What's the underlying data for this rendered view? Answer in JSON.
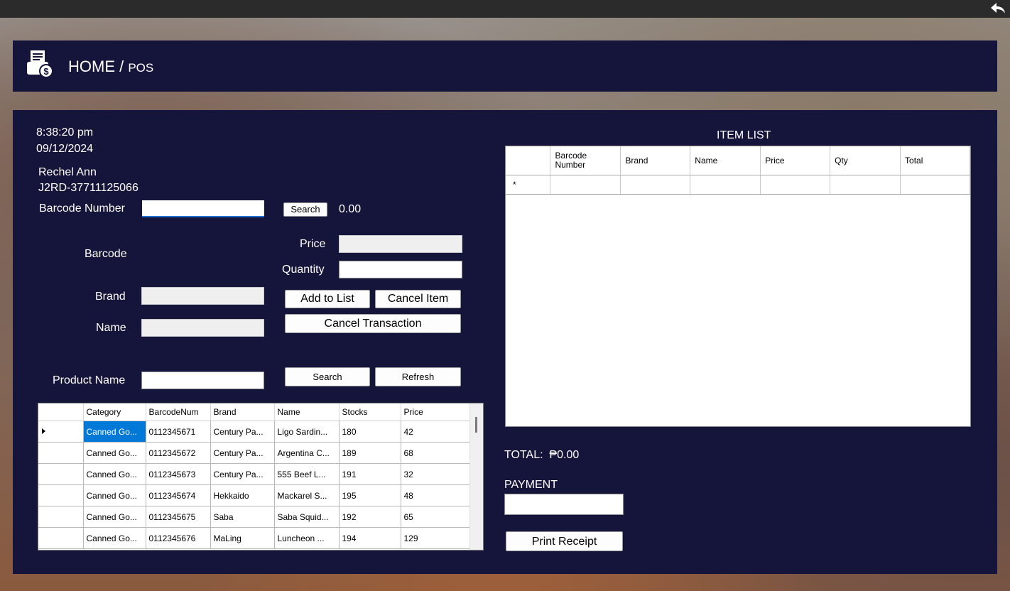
{
  "header": {
    "title": "HOME",
    "separator": " / ",
    "subtitle": "POS"
  },
  "info": {
    "time": "8:38:20 pm",
    "date": "09/12/2024",
    "user_name": "Rechel Ann",
    "user_id": "J2RD-37711125066"
  },
  "barcode_search": {
    "label": "Barcode Number",
    "value": "",
    "button": "Search",
    "amount": "0.00"
  },
  "form": {
    "barcode_label": "Barcode",
    "price_label": "Price",
    "price_value": "",
    "quantity_label": "Quantity",
    "quantity_value": "",
    "brand_label": "Brand",
    "brand_value": "",
    "name_label": "Name",
    "name_value": ""
  },
  "actions": {
    "add_to_list": "Add to List",
    "cancel_item": "Cancel Item",
    "cancel_transaction": "Cancel Transaction"
  },
  "product_search": {
    "label": "Product Name",
    "value": "",
    "search_button": "Search",
    "refresh_button": "Refresh"
  },
  "products": {
    "columns": [
      "Category",
      "BarcodeNum",
      "Brand",
      "Name",
      "Stocks",
      "Price"
    ],
    "rows": [
      [
        "Canned Go...",
        "0112345671",
        "Century Pa...",
        "Ligo Sardin...",
        "180",
        "42"
      ],
      [
        "Canned Go...",
        "0112345672",
        "Century Pa...",
        "Argentina C...",
        "189",
        "68"
      ],
      [
        "Canned Go...",
        "0112345673",
        "Century Pa...",
        "555 Beef L...",
        "191",
        "32"
      ],
      [
        "Canned Go...",
        "0112345674",
        "Hekkaido",
        "Mackarel S...",
        "195",
        "48"
      ],
      [
        "Canned Go...",
        "0112345675",
        "Saba",
        "Saba Squid...",
        "192",
        "65"
      ],
      [
        "Canned Go...",
        "0112345676",
        "MaLing",
        "Luncheon ...",
        "194",
        "129"
      ]
    ]
  },
  "item_list": {
    "title": "ITEM LIST",
    "columns": [
      "Barcode Number",
      "Brand",
      "Name",
      "Price",
      "Qty",
      "Total"
    ],
    "new_row_marker": "*"
  },
  "totals": {
    "total_label": "TOTAL:",
    "total_value": "₱0.00",
    "payment_label": "PAYMENT",
    "payment_value": "",
    "print_button": "Print Receipt"
  },
  "colors": {
    "panel": "#15143a",
    "selection": "#0078d7",
    "topbar": "#2b2b2b"
  },
  "icons": {
    "back": "back-arrow-icon",
    "logo": "receipt-dollar-icon"
  }
}
